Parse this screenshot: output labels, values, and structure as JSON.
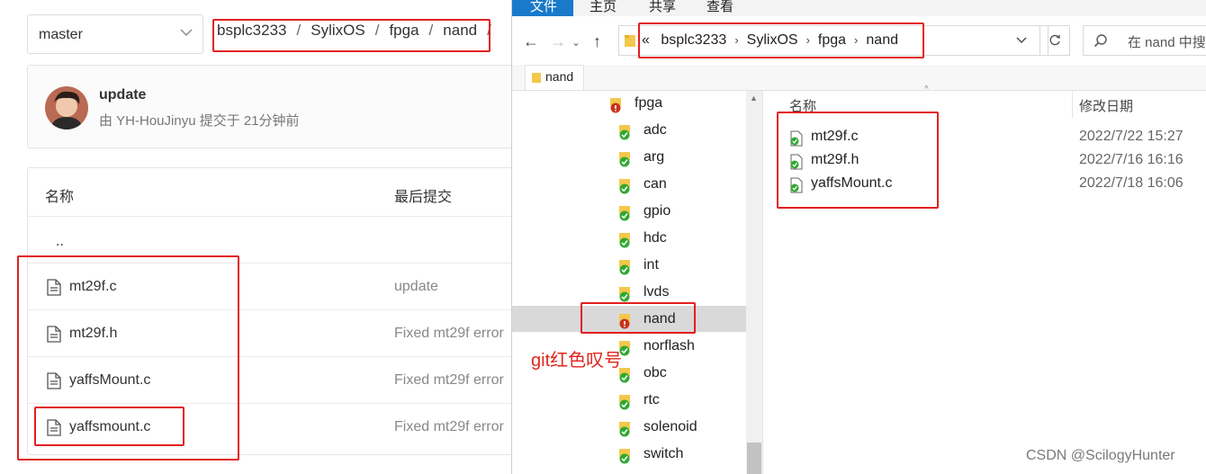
{
  "web": {
    "branch": "master",
    "breadcrumb": [
      "bsplc3233",
      "SylixOS",
      "fpga",
      "nand",
      "/"
    ],
    "commit": {
      "title": "update",
      "meta": "由 YH-HouJinyu 提交于 21分钟前"
    },
    "table": {
      "col_name": "名称",
      "col_commit": "最后提交",
      "parent": "..",
      "files": [
        {
          "name": "mt29f.c",
          "commit": "update"
        },
        {
          "name": "mt29f.h",
          "commit": "Fixed mt29f error"
        },
        {
          "name": "yaffsMount.c",
          "commit": "Fixed mt29f error"
        },
        {
          "name": "yaffsmount.c",
          "commit": "Fixed mt29f error"
        }
      ]
    }
  },
  "explorer": {
    "ribbon": {
      "file": "文件",
      "home": "主页",
      "share": "共享",
      "view": "查看"
    },
    "address": {
      "lead": "«",
      "parts": [
        "bsplc3233",
        "SylixOS",
        "fpga",
        "nand"
      ]
    },
    "search_placeholder": "在 nand 中搜",
    "tab": "nand",
    "tree": [
      "fpga",
      "adc",
      "arg",
      "can",
      "gpio",
      "hdc",
      "int",
      "lvds",
      "nand",
      "norflash",
      "obc",
      "rtc",
      "solenoid",
      "switch"
    ],
    "tree_selected": "nand",
    "columns": {
      "name": "名称",
      "date": "修改日期"
    },
    "files": [
      {
        "name": "mt29f.c",
        "date": "2022/7/22 15:27"
      },
      {
        "name": "mt29f.h",
        "date": "2022/7/16 16:16"
      },
      {
        "name": "yaffsMount.c",
        "date": "2022/7/18 16:06"
      }
    ]
  },
  "annotation": "git红色叹号",
  "watermark": "CSDN @ScilogyHunter",
  "colors": {
    "highlight": "#e21f1f",
    "accent": "#1979ca",
    "git_ok": "#2fa82f",
    "git_conflict": "#c8331e"
  }
}
